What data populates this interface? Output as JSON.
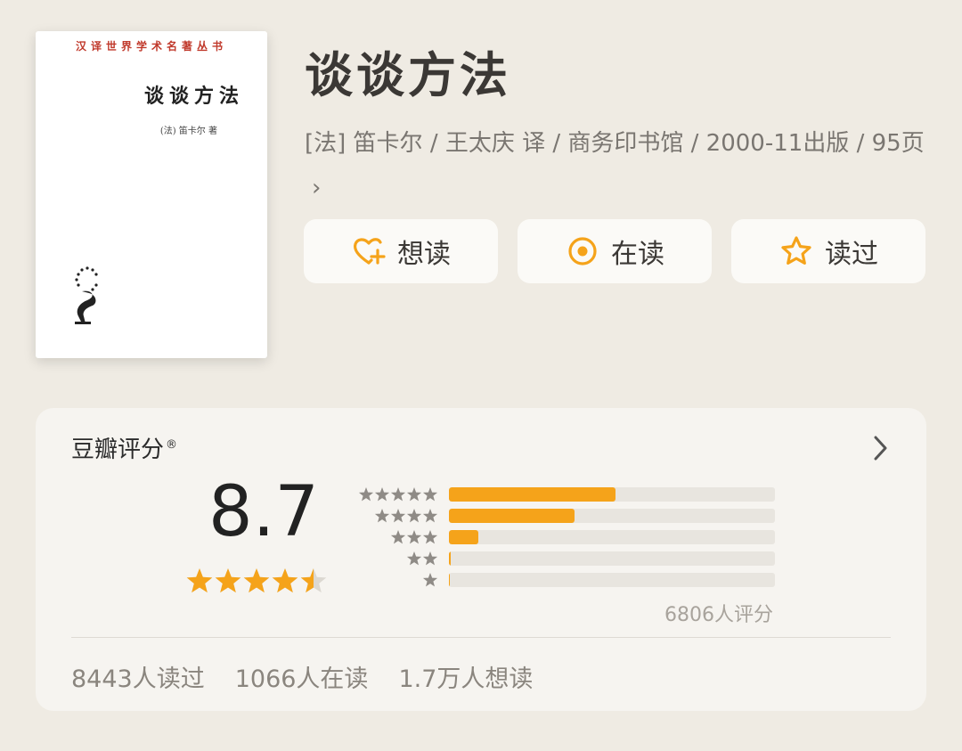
{
  "cover": {
    "series": "汉译世界学术名著丛书",
    "title": "谈谈方法",
    "author": "(法) 笛卡尔 著"
  },
  "book": {
    "title": "谈谈方法",
    "meta": "[法] 笛卡尔 / 王太庆 译 / 商务印书馆 / 2000-11出版 / 95页",
    "meta_chevron": "›"
  },
  "actions": [
    {
      "label": "想读",
      "icon": "heart-plus-icon"
    },
    {
      "label": "在读",
      "icon": "target-icon"
    },
    {
      "label": "读过",
      "icon": "star-outline-icon"
    }
  ],
  "rating": {
    "title": "豆瓣评分",
    "registered_mark": "®",
    "score": "8.7",
    "stars": 4.5,
    "distribution": [
      {
        "stars": 5,
        "fraction": 0.51
      },
      {
        "stars": 4,
        "fraction": 0.385
      },
      {
        "stars": 3,
        "fraction": 0.09
      },
      {
        "stars": 2,
        "fraction": 0.006
      },
      {
        "stars": 1,
        "fraction": 0.003
      }
    ],
    "count_text": "6806人评分"
  },
  "stats": {
    "read": "8443人读过",
    "reading": "1066人在读",
    "wish": "1.7万人想读"
  },
  "colors": {
    "accent": "#f5a31a",
    "background": "#efebe3",
    "card": "#f6f4f0",
    "button": "#fbfaf7",
    "muted_star": "#8f8b86"
  }
}
